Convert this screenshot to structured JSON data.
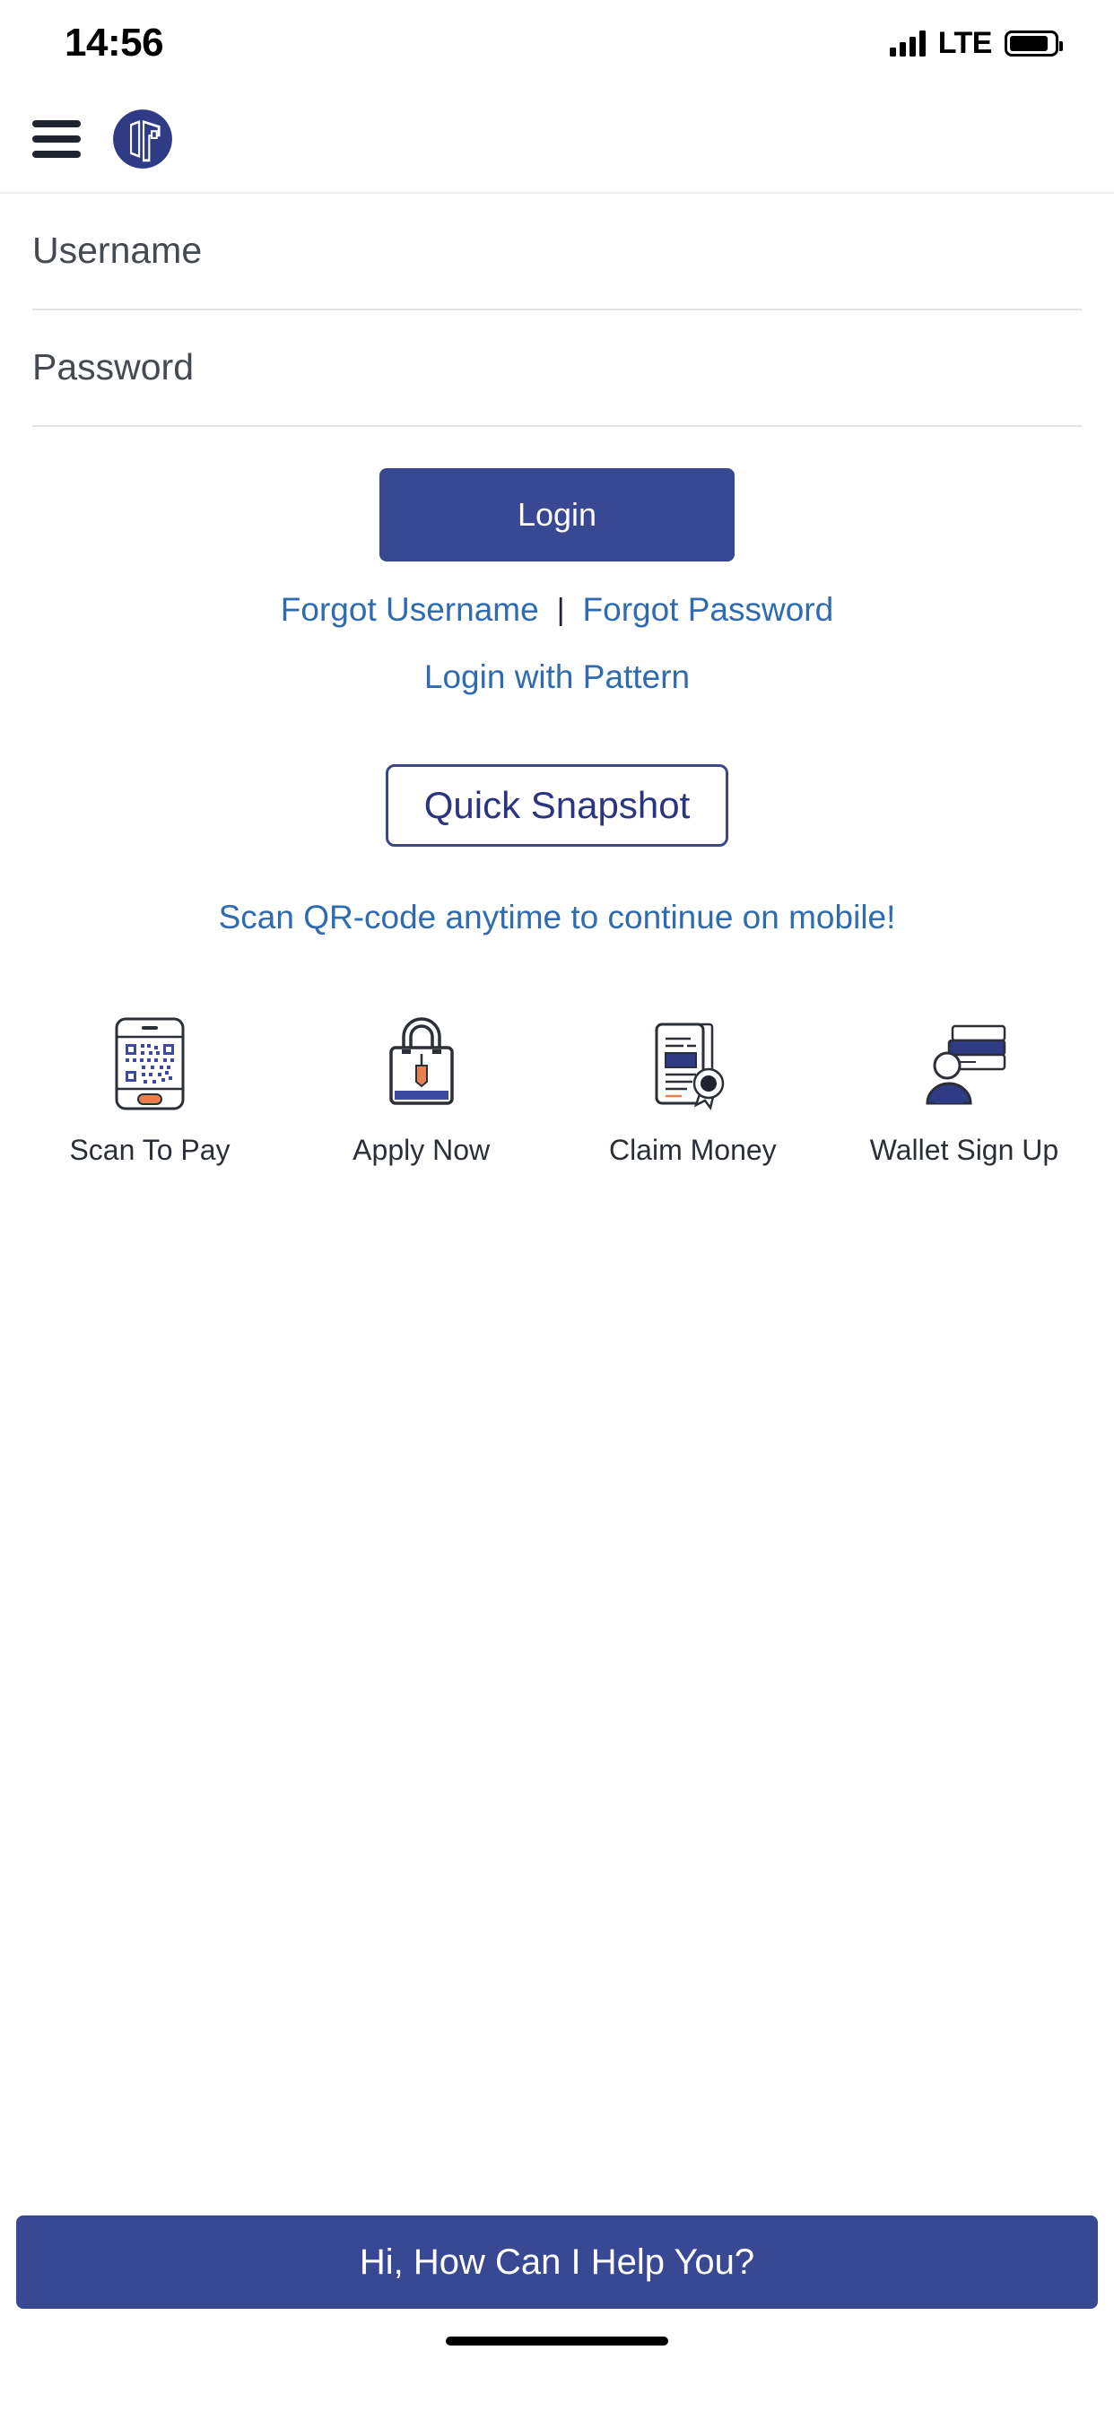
{
  "status_bar": {
    "time": "14:56",
    "network_label": "LTE",
    "signal_icon": "signal-bars-icon",
    "battery_icon": "battery-icon"
  },
  "header": {
    "menu_icon": "hamburger-menu-icon",
    "logo_icon": "bank-logo-icon"
  },
  "form": {
    "username": {
      "placeholder": "Username",
      "value": ""
    },
    "password": {
      "placeholder": "Password",
      "value": ""
    }
  },
  "actions": {
    "login_label": "Login",
    "forgot_username": "Forgot Username",
    "separator": "|",
    "forgot_password": "Forgot Password",
    "login_with_pattern": "Login with Pattern",
    "quick_snapshot": "Quick Snapshot"
  },
  "promo": {
    "qr_note": "Scan QR-code anytime to continue on mobile!"
  },
  "shortcuts": [
    {
      "label": "Scan To Pay",
      "icon": "phone-qr-icon"
    },
    {
      "label": "Apply Now",
      "icon": "shopping-bag-icon"
    },
    {
      "label": "Claim Money",
      "icon": "certificate-award-icon"
    },
    {
      "label": "Wallet Sign Up",
      "icon": "person-cards-icon"
    }
  ],
  "chat": {
    "label": "Hi, How Can I Help You?"
  },
  "colors": {
    "primary_blue": "#384893",
    "link_blue": "#2f6bb0",
    "outline_blue": "#3d4785",
    "accent_orange": "#e8804f",
    "text_dark": "#3c4043",
    "divider": "#e2e4e7"
  }
}
